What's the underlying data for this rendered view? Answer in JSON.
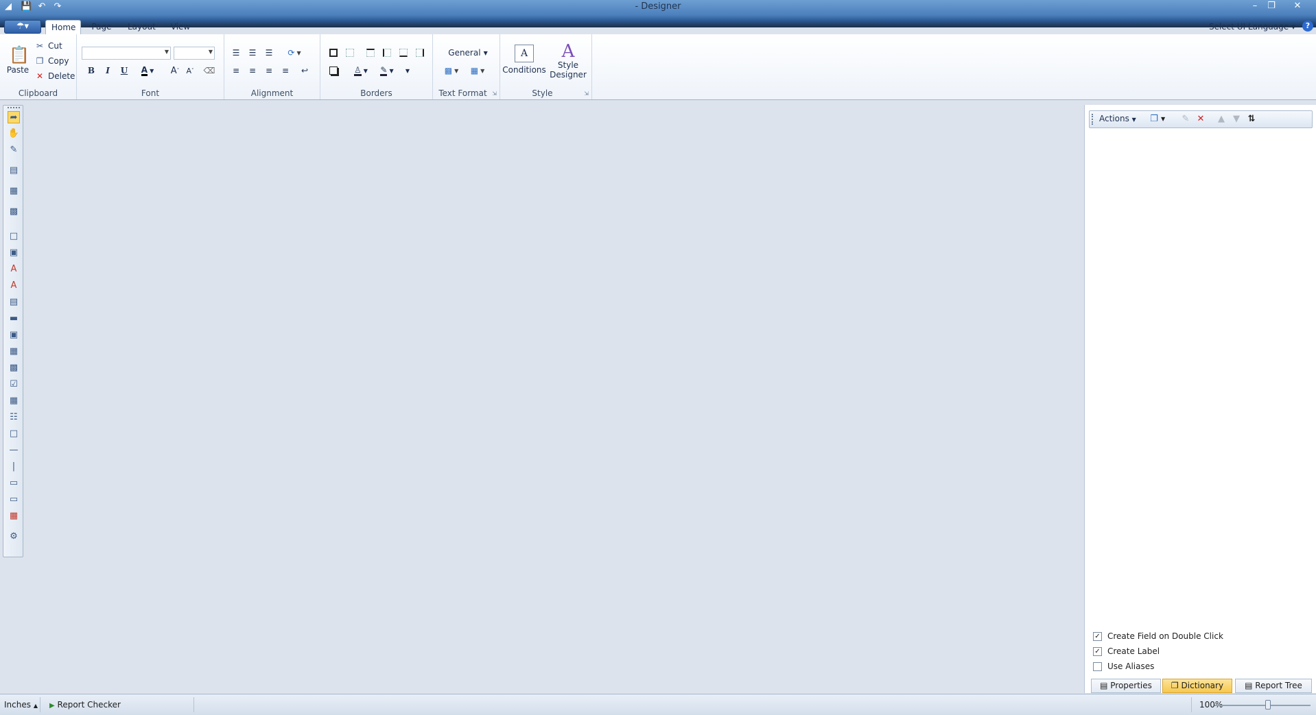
{
  "window": {
    "title": "- Designer"
  },
  "menu": {
    "tabs": [
      {
        "label": "Home"
      },
      {
        "label": "Page"
      },
      {
        "label": "Layout"
      },
      {
        "label": "View"
      }
    ],
    "language": "Select UI Language",
    "help": "?"
  },
  "ribbon": {
    "clipboard": {
      "label": "Clipboard",
      "paste": "Paste",
      "cut": "Cut",
      "copy": "Copy",
      "delete": "Delete"
    },
    "font": {
      "label": "Font",
      "bold": "B",
      "italic": "I",
      "underline": "U",
      "font_color": "A",
      "grow": "A",
      "shrink": "A"
    },
    "alignment": {
      "label": "Alignment"
    },
    "borders": {
      "label": "Borders"
    },
    "text_format": {
      "label": "Text Format",
      "format": "General"
    },
    "style": {
      "label": "Style",
      "conditions": "Conditions",
      "style_designer_1": "Style",
      "style_designer_2": "Designer"
    }
  },
  "dictionary": {
    "actions": "Actions",
    "options": [
      {
        "label": "Create Field on Double Click",
        "checked": true
      },
      {
        "label": "Create Label",
        "checked": true
      },
      {
        "label": "Use Aliases",
        "checked": false
      }
    ]
  },
  "panel_tabs": [
    {
      "label": "Properties",
      "active": false
    },
    {
      "label": "Dictionary",
      "active": true
    },
    {
      "label": "Report Tree",
      "active": false
    }
  ],
  "status": {
    "units": "Inches",
    "checker": "Report Checker",
    "zoom": "100%"
  }
}
